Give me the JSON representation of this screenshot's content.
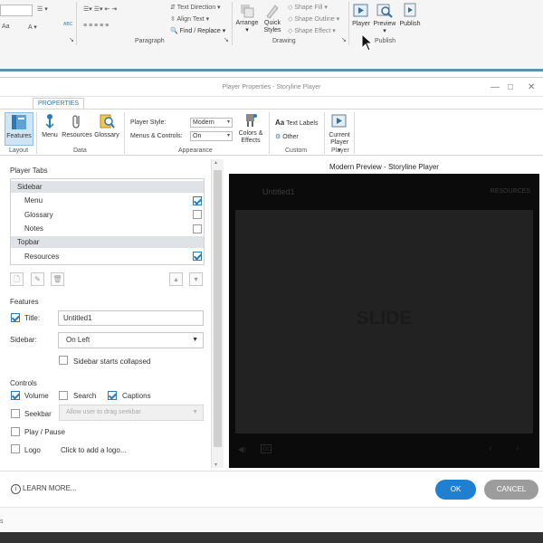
{
  "background_ribbon": {
    "groups": {
      "paragraph": "Paragraph",
      "drawing": "Drawing",
      "publish": "Publish"
    },
    "paragraph": {
      "text_direction": "Text Direction",
      "align_text": "Align Text",
      "find_replace": "Find / Replace"
    },
    "drawing": {
      "arrange": "Arrange",
      "quick_styles": "Quick Styles",
      "shape_fill": "Shape Fill",
      "shape_outline": "Shape Outline",
      "shape_effect": "Shape Effect"
    },
    "publish": {
      "player": "Player",
      "preview": "Preview",
      "publish": "Publish"
    },
    "font_row_label": "Aa",
    "abc_label": "ABC"
  },
  "dialog": {
    "title": "Player Properties - Storyline Player",
    "tab": "PROPERTIES",
    "ribbon": {
      "layout_group": "Layout",
      "data_group": "Data",
      "appearance_group": "Appearance",
      "custom_group": "Custom",
      "player_group": "Player",
      "features": "Features",
      "menu": "Menu",
      "resources": "Resources",
      "glossary": "Glossary",
      "player_style_label": "Player Style:",
      "player_style_value": "Modern",
      "menus_controls_label": "Menus & Controls:",
      "menus_controls_value": "On",
      "colors_effects": "Colors & Effects",
      "text_labels": "Text Labels",
      "other": "Other",
      "current_player": "Current Player",
      "text_labels_icon_text": "Aa"
    },
    "player_tabs": {
      "title": "Player Tabs",
      "sidebar_group": "Sidebar",
      "topbar_group": "Topbar",
      "items": [
        {
          "label": "Menu",
          "checked": true
        },
        {
          "label": "Glossary",
          "checked": false
        },
        {
          "label": "Notes",
          "checked": false
        },
        {
          "label": "Resources",
          "checked": true
        }
      ]
    },
    "features": {
      "title": "Features",
      "title_label": "Title:",
      "title_value": "Untitled1",
      "sidebar_label": "Sidebar:",
      "sidebar_value": "On Left",
      "collapsed_label": "Sidebar starts collapsed"
    },
    "controls": {
      "title": "Controls",
      "volume": "Volume",
      "search": "Search",
      "captions": "Captions",
      "seekbar": "Seekbar",
      "seekbar_option": "Allow user to drag seekbar",
      "play_pause": "Play / Pause",
      "logo": "Logo",
      "logo_action": "Click to add a logo..."
    },
    "preview": {
      "title": "Modern Preview - Storyline Player",
      "slide_title": "Untitled1",
      "resources": "RESOURCES",
      "slide_label": "SLIDE"
    },
    "footer": {
      "learn_more": "LEARN MORE...",
      "ok": "OK",
      "cancel": "CANCEL"
    }
  },
  "colors": {
    "accent": "#2a7ab8",
    "ok_button": "#1f7fd1",
    "cancel_button": "#9c9c9c",
    "preview_bg": "#0b0b0b"
  }
}
